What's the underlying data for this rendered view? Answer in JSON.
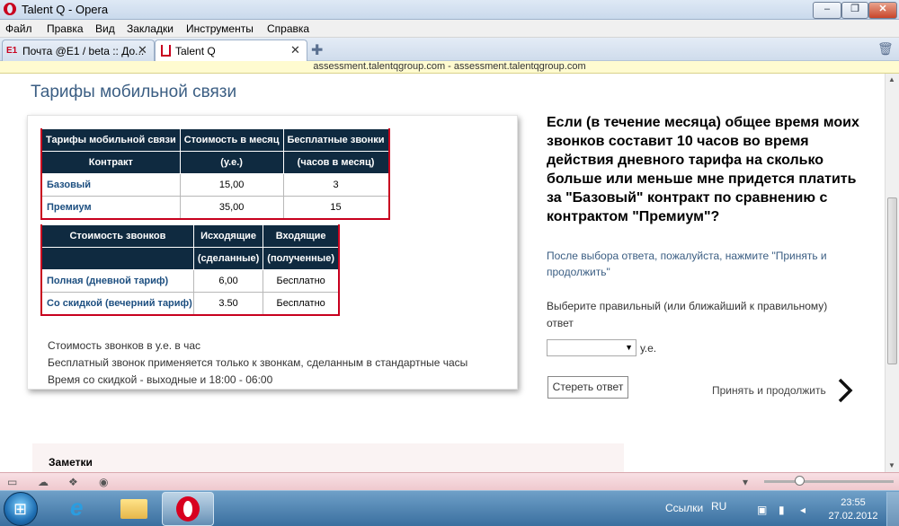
{
  "window": {
    "title": "Talent Q - Opera"
  },
  "menu": [
    "Файл",
    "Правка",
    "Вид",
    "Закладки",
    "Инструменты",
    "Справка"
  ],
  "tabs": [
    {
      "label": "Почта @E1 / beta :: До..."
    },
    {
      "label": "Talent Q"
    }
  ],
  "address": "assessment.talentqgroup.com - assessment.talentqgroup.com",
  "page": {
    "title": "Тарифы мобильной связи",
    "table1": {
      "header1": [
        "Тарифы мобильной связи",
        "Стоимость в месяц",
        "Бесплатные звонки"
      ],
      "header2": [
        "Контракт",
        "(у.е.)",
        "(часов в месяц)"
      ],
      "rows": [
        [
          "Базовый",
          "15,00",
          "3"
        ],
        [
          "Премиум",
          "35,00",
          "15"
        ]
      ]
    },
    "table2": {
      "header1": [
        "Стоимость звонков",
        "Исходящие",
        "Входящие"
      ],
      "header2": [
        "",
        "(сделанные)",
        "(полученные)"
      ],
      "rows": [
        [
          "Полная (дневной тариф)",
          "6,00",
          "Бесплатно"
        ],
        [
          "Со скидкой (вечерний тариф)",
          "3.50",
          "Бесплатно"
        ]
      ]
    },
    "notes": [
      "Стоимость звонков в у.е. в час",
      "Бесплатный звонок применяется только к звонкам, сделанным в стандартные часы",
      "Время со скидкой - выходные и 18:00 - 06:00"
    ],
    "question": "Если (в течение месяца) общее время моих звонков составит 10 часов во время действия дневного тарифа на сколько больше или меньше мне придется платить за \"Базовый\" контракт по сравнению с контрактом \"Премиум\"?",
    "instruction": "После выбора ответа, пожалуйста, нажмите \"Принять и продолжить\"",
    "select_label": "Выберите правильный (или ближайший к правильному) ответ",
    "select_value": "",
    "unit": "у.е.",
    "erase_button": "Стереть ответ",
    "accept_button": "Принять и продолжить",
    "notes_section": "Заметки"
  },
  "taskbar": {
    "links": "Ссылки",
    "lang": "RU",
    "time": "23:55",
    "date": "27.02.2012"
  },
  "colors": {
    "accent": "#0f2a40",
    "link": "#3b5e83",
    "opera_red": "#c8001e"
  }
}
